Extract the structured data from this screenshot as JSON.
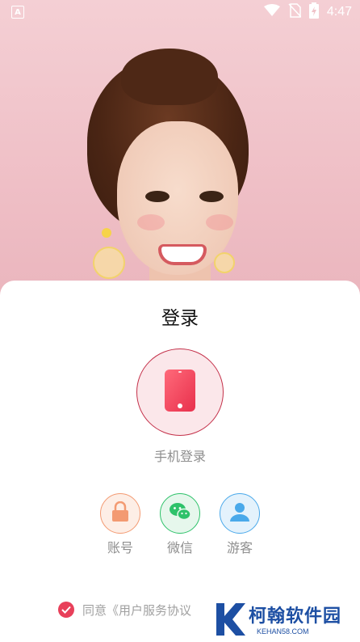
{
  "status_bar": {
    "app_icon_letter": "A",
    "time": "4:47"
  },
  "login": {
    "title": "登录",
    "phone_login_label": "手机登录",
    "options": [
      {
        "label": "账号",
        "icon": "lock-icon",
        "color": "#f39a72"
      },
      {
        "label": "微信",
        "icon": "wechat-icon",
        "color": "#2ec26a"
      },
      {
        "label": "游客",
        "icon": "user-icon",
        "color": "#4aa9ea"
      }
    ],
    "agreement_text": "同意《用户服务协议"
  },
  "watermark": {
    "name": "柯翰软件园",
    "domain": "KEHAN58.COM"
  },
  "colors": {
    "accent": "#e8405a",
    "phone_ring": "#c4314a",
    "watermark": "#1d4fa3"
  }
}
